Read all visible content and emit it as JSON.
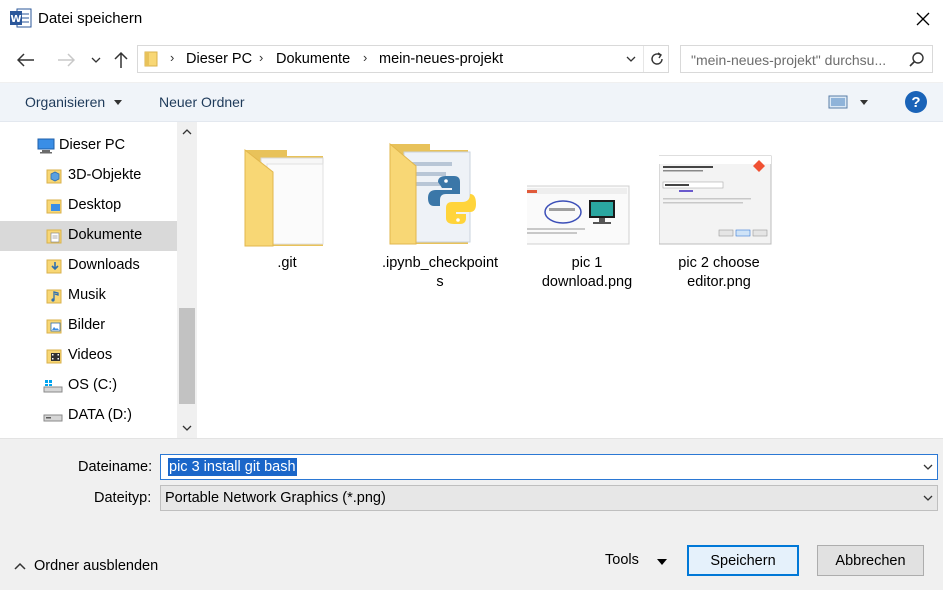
{
  "window": {
    "title": "Datei speichern",
    "app_icon": "word-icon",
    "close_icon": "close-icon"
  },
  "nav": {
    "back_icon": "arrow-left-icon",
    "forward_icon": "arrow-right-icon",
    "recent_icon": "chevron-down-icon",
    "up_icon": "arrow-up-icon",
    "breadcrumb": [
      "Dieser PC",
      "Dokumente",
      "mein-neues-projekt"
    ],
    "refresh_icon": "refresh-icon",
    "search_placeholder": "\"mein-neues-projekt\" durchsu...",
    "search_icon": "search-icon"
  },
  "toolbar": {
    "organize_label": "Organisieren",
    "new_folder_label": "Neuer Ordner",
    "view_icon": "view-options-icon",
    "help_label": "?"
  },
  "sidebar": {
    "items": [
      {
        "label": "Dieser PC",
        "icon": "computer-icon"
      },
      {
        "label": "3D-Objekte",
        "icon": "3d-objects-icon"
      },
      {
        "label": "Desktop",
        "icon": "desktop-folder-icon"
      },
      {
        "label": "Dokumente",
        "icon": "documents-folder-icon",
        "selected": true
      },
      {
        "label": "Downloads",
        "icon": "downloads-folder-icon"
      },
      {
        "label": "Musik",
        "icon": "music-folder-icon"
      },
      {
        "label": "Bilder",
        "icon": "pictures-folder-icon"
      },
      {
        "label": "Videos",
        "icon": "videos-folder-icon"
      },
      {
        "label": "OS (C:)",
        "icon": "windows-drive-icon"
      },
      {
        "label": "DATA (D:)",
        "icon": "drive-icon"
      }
    ]
  },
  "files": [
    {
      "label": ".git",
      "type": "folder"
    },
    {
      "label": ".ipynb_checkpoints",
      "type": "python-folder"
    },
    {
      "label": "pic 1 download.png",
      "type": "image"
    },
    {
      "label": "pic 2 choose editor.png",
      "type": "image"
    }
  ],
  "save": {
    "filename_label": "Dateiname:",
    "filename_value": "pic 3 install git bash",
    "filetype_label": "Dateityp:",
    "filetype_value": "Portable Network Graphics (*.png)",
    "hide_folders_label": "Ordner ausblenden",
    "tools_label": "Tools",
    "save_label": "Speichern",
    "cancel_label": "Abbrechen"
  },
  "colors": {
    "accent": "#0078d7",
    "selection": "#1a66c9",
    "folder_yellow": "#f8d775"
  }
}
